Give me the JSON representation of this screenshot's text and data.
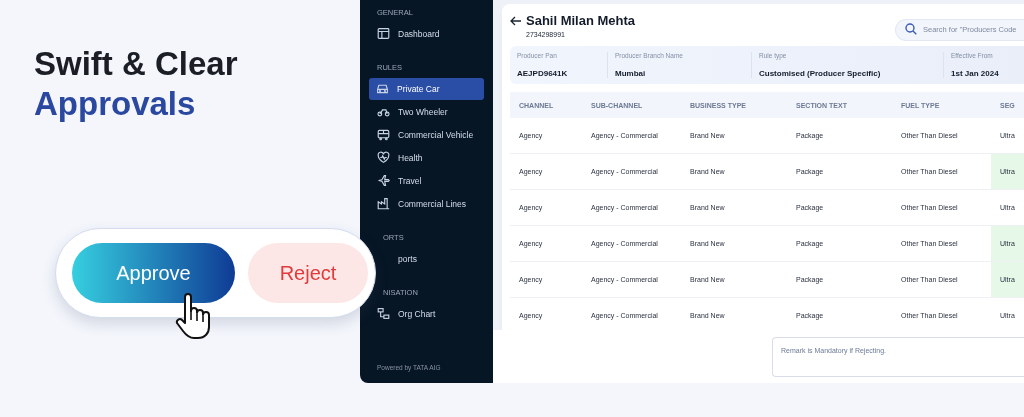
{
  "hero": {
    "title_line1": "Swift & Clear",
    "title_line2": "Approvals"
  },
  "action_card": {
    "buttons": [
      {
        "label": "Approve",
        "kind": "approve"
      },
      {
        "label": "Reject",
        "kind": "reject"
      }
    ]
  },
  "sidebar": {
    "sections": [
      {
        "label": "GENERAL",
        "items": [
          {
            "label": "Dashboard",
            "selected": false
          }
        ]
      },
      {
        "label": "RULES",
        "items": [
          {
            "label": "Private Car",
            "selected": true
          },
          {
            "label": "Two Wheeler",
            "selected": false
          },
          {
            "label": "Commercial Vehicle",
            "selected": false
          },
          {
            "label": "Health",
            "selected": false
          },
          {
            "label": "Travel",
            "selected": false
          },
          {
            "label": "Commercial Lines",
            "selected": false
          }
        ]
      },
      {
        "label": "ORTS",
        "items": [
          {
            "label": "ports",
            "selected": false
          }
        ]
      },
      {
        "label": "NISATION",
        "items": [
          {
            "label": "Org Chart",
            "selected": false
          }
        ]
      }
    ],
    "footer": "Powered by TATA AIG"
  },
  "header": {
    "name": "Sahil Milan Mehta",
    "number": "2734298991",
    "search": {
      "placeholder": "Search for \"Producers Code"
    }
  },
  "info_bar": [
    {
      "label": "Producer Pan",
      "value": "AEJPD9641K"
    },
    {
      "label": "Producer Branch Name",
      "value": "Mumbai"
    },
    {
      "label": "Rule type",
      "value": "Customised (Producer Specific)"
    },
    {
      "label": "Effective From",
      "value": "1st Jan 2024"
    }
  ],
  "table": {
    "columns": [
      "CHANNEL",
      "SUB-CHANNEL",
      "BUSINESS TYPE",
      "SECTION TEXT",
      "FUEL TYPE",
      "SEG"
    ],
    "rows": [
      {
        "cells": [
          "Agency",
          "Agency - Commercial",
          "Brand New",
          "Package",
          "Other Than Diesel",
          "Ultra"
        ],
        "highlighted": false
      },
      {
        "cells": [
          "Agency",
          "Agency - Commercial",
          "Brand New",
          "Package",
          "Other Than Diesel",
          "Ultra"
        ],
        "highlighted": true
      },
      {
        "cells": [
          "Agency",
          "Agency - Commercial",
          "Brand New",
          "Package",
          "Other Than Diesel",
          "Ultra"
        ],
        "highlighted": false
      },
      {
        "cells": [
          "Agency",
          "Agency - Commercial",
          "Brand New",
          "Package",
          "Other Than Diesel",
          "Ultra"
        ],
        "highlighted": true
      },
      {
        "cells": [
          "Agency",
          "Agency - Commercial",
          "Brand New",
          "Package",
          "Other Than Diesel",
          "Ultra"
        ],
        "highlighted": true
      },
      {
        "cells": [
          "Agency",
          "Agency - Commercial",
          "Brand New",
          "Package",
          "Other Than Diesel",
          "Ultra"
        ],
        "highlighted": false
      }
    ]
  },
  "remark": {
    "placeholder": "Remark is Mandatory if Rejecting."
  }
}
